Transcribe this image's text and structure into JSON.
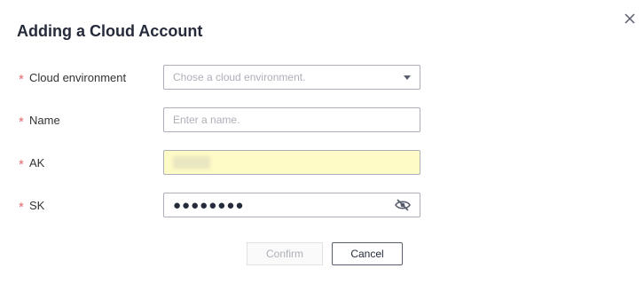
{
  "dialog": {
    "title": "Adding a Cloud Account"
  },
  "form": {
    "required_mark": "*",
    "cloud_environment": {
      "label": "Cloud environment",
      "placeholder": "Chose a cloud environment."
    },
    "name": {
      "label": "Name",
      "placeholder": "Enter a name.",
      "value": ""
    },
    "ak": {
      "label": "AK",
      "value_hidden": true,
      "autofill_color": "#fffbc6"
    },
    "sk": {
      "label": "SK",
      "masked_value": "●●●●●●●●"
    }
  },
  "buttons": {
    "confirm": "Confirm",
    "cancel": "Cancel"
  },
  "icons": {
    "close": "close-icon",
    "dropdown": "chevron-down-icon",
    "toggle_visibility": "eye-off-icon"
  },
  "colors": {
    "required": "#e86a6a",
    "border": "#adb0b8"
  }
}
